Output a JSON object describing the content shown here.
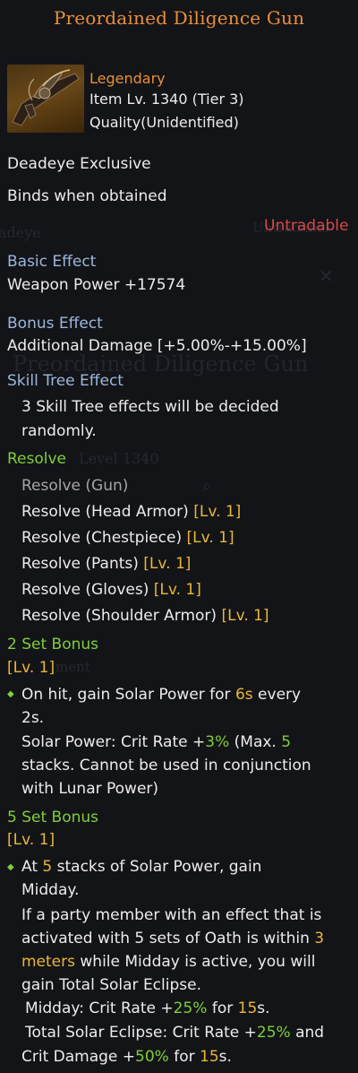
{
  "header": {
    "title": "Preordained Diligence Gun"
  },
  "item": {
    "rarity": "Legendary",
    "item_level": "Item Lv. 1340 (Tier 3)",
    "quality": "Quality(Unidentified)",
    "class_lock": "Deadeye Exclusive",
    "binding": "Binds when obtained",
    "trade_status": "Untradable"
  },
  "background_text": {
    "class_name": "adeye",
    "item_name": "Preordained Diligence Gun",
    "level": "Level 1340",
    "equip": "ment"
  },
  "basic_effect": {
    "label": "Basic Effect",
    "value": "Weapon Power +17574"
  },
  "bonus_effect": {
    "label": "Bonus Effect",
    "value": "Additional Damage [+5.00%-+15.00%]"
  },
  "skill_tree": {
    "label": "Skill Tree Effect",
    "line1": "3 Skill Tree effects will be decided",
    "line2": "randomly."
  },
  "resolve": {
    "label": "Resolve",
    "items": [
      {
        "name": "Resolve (Gun)",
        "level": ""
      },
      {
        "name": "Resolve (Head Armor)",
        "level": "[Lv. 1]"
      },
      {
        "name": "Resolve (Chestpiece)",
        "level": "[Lv. 1]"
      },
      {
        "name": "Resolve (Pants)",
        "level": "[Lv. 1]"
      },
      {
        "name": "Resolve (Gloves)",
        "level": "[Lv. 1]"
      },
      {
        "name": "Resolve (Shoulder Armor)",
        "level": "[Lv. 1]"
      }
    ]
  },
  "set2": {
    "label": "2 Set Bonus",
    "level": "[Lv. 1]",
    "l1a": "On hit, gain Solar Power for ",
    "l1b": "6s",
    "l1c": " every",
    "l2": "2s.",
    "l3a": "Solar Power: Crit Rate +",
    "l3b": "3%",
    "l3c": " (Max. ",
    "l3d": "5",
    "l4": "stacks. Cannot be used in conjunction",
    "l5": "with Lunar Power)"
  },
  "set5": {
    "label": "5 Set Bonus",
    "level": "[Lv. 1]",
    "l1a": "At ",
    "l1b": "5",
    "l1c": " stacks of Solar Power, gain",
    "l2": "Midday.",
    "l3": "If a party member with an effect that is",
    "l4a": "activated with 5 sets of Oath is within ",
    "l4b": "3",
    "l5a": "meters",
    "l5b": " while Midday is active, you will",
    "l6": "gain Total Solar Eclipse.",
    "l7a": "Midday: Crit Rate +",
    "l7b": "25%",
    "l7c": " for ",
    "l7d": "15",
    "l7e": "s.",
    "l8a": "Total Solar Eclipse: Crit Rate +",
    "l8b": "25%",
    "l8c": " and",
    "l9a": "Crit Damage +",
    "l9b": "50%",
    "l9c": " for ",
    "l9d": "15",
    "l9e": "s."
  }
}
